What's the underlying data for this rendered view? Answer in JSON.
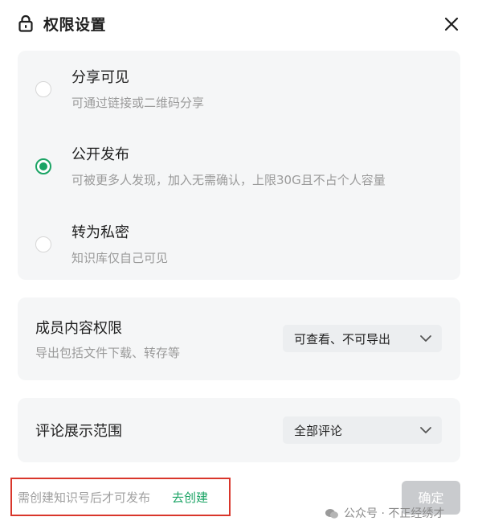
{
  "header": {
    "title": "权限设置",
    "lock_icon": "lock-icon",
    "close_icon": "close-icon"
  },
  "visibility": {
    "options": [
      {
        "title": "分享可见",
        "desc": "可通过链接或二维码分享",
        "checked": false
      },
      {
        "title": "公开发布",
        "desc": "可被更多人发现，加入无需确认，上限30G且不占个人容量",
        "checked": true
      },
      {
        "title": "转为私密",
        "desc": "知识库仅自己可见",
        "checked": false
      }
    ]
  },
  "member_permission": {
    "title": "成员内容权限",
    "desc": "导出包括文件下载、转存等",
    "selected": "可查看、不可导出"
  },
  "comment_scope": {
    "title": "评论展示范围",
    "selected": "全部评论"
  },
  "footer": {
    "notice": "需创建知识号后才可发布",
    "create_link": "去创建",
    "confirm": "确定",
    "watermark": "公众号 · 不正经绣才"
  },
  "colors": {
    "accent": "#1aa364",
    "highlight_border": "#d9362b",
    "disabled_button": "#c9cbce",
    "card_bg": "#f5f6f7"
  }
}
